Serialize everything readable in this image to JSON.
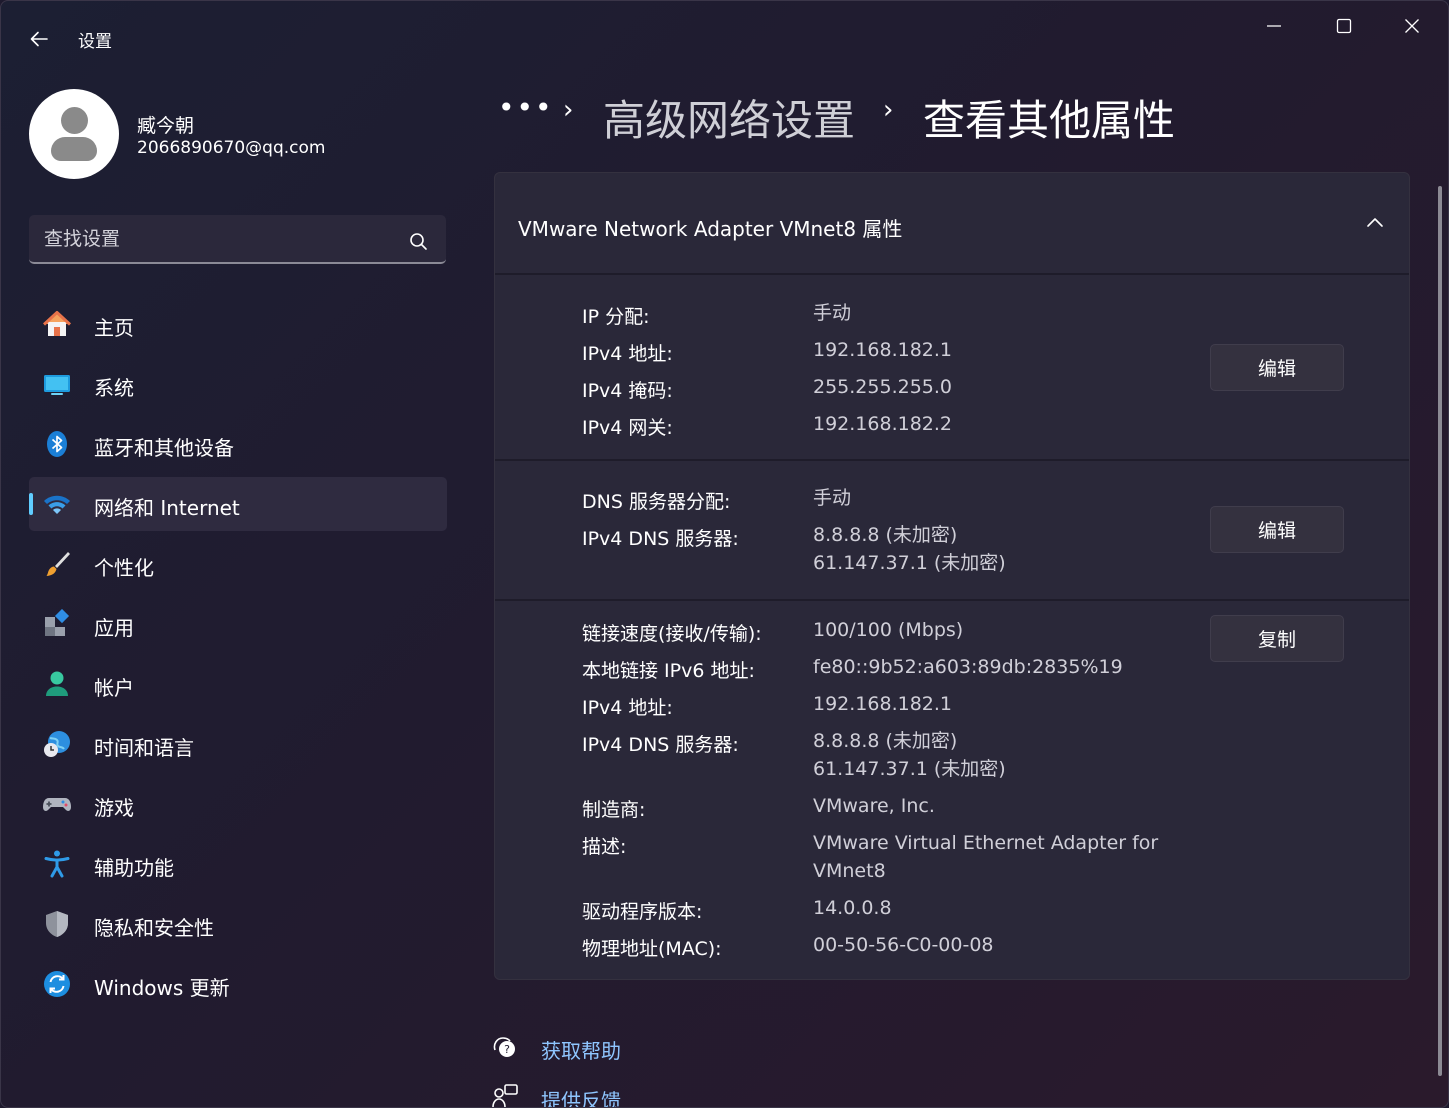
{
  "window": {
    "title": "设置"
  },
  "profile": {
    "name": "臧今朝",
    "email": "2066890670@qq.com"
  },
  "search": {
    "placeholder": "查找设置"
  },
  "nav": {
    "items": [
      {
        "label": "主页",
        "icon": "home-icon"
      },
      {
        "label": "系统",
        "icon": "system-icon"
      },
      {
        "label": "蓝牙和其他设备",
        "icon": "bluetooth-icon"
      },
      {
        "label": "网络和 Internet",
        "icon": "wifi-icon",
        "active": true
      },
      {
        "label": "个性化",
        "icon": "brush-icon"
      },
      {
        "label": "应用",
        "icon": "apps-icon"
      },
      {
        "label": "帐户",
        "icon": "account-icon"
      },
      {
        "label": "时间和语言",
        "icon": "globe-clock-icon"
      },
      {
        "label": "游戏",
        "icon": "gamepad-icon"
      },
      {
        "label": "辅助功能",
        "icon": "accessibility-icon"
      },
      {
        "label": "隐私和安全性",
        "icon": "shield-icon"
      },
      {
        "label": "Windows 更新",
        "icon": "update-icon"
      }
    ]
  },
  "breadcrumb": {
    "more": "•••",
    "separator": "›",
    "parent": "高级网络设置",
    "current": "查看其他属性"
  },
  "card": {
    "title": "VMware Network Adapter VMnet8 属性",
    "ip_section": {
      "rows": [
        {
          "label": "IP 分配:",
          "value": "手动"
        },
        {
          "label": "IPv4 地址:",
          "value": "192.168.182.1"
        },
        {
          "label": "IPv4 掩码:",
          "value": "255.255.255.0"
        },
        {
          "label": "IPv4 网关:",
          "value": "192.168.182.2"
        }
      ],
      "button": "编辑"
    },
    "dns_section": {
      "rows": [
        {
          "label": "DNS 服务器分配:",
          "value": "手动"
        },
        {
          "label": "IPv4 DNS 服务器:",
          "value": "8.8.8.8 (未加密)",
          "value2": "61.147.37.1 (未加密)"
        }
      ],
      "button": "编辑"
    },
    "info_section": {
      "rows": [
        {
          "label": "链接速度(接收/传输):",
          "value": "100/100 (Mbps)"
        },
        {
          "label": "本地链接 IPv6 地址:",
          "value": "fe80::9b52:a603:89db:2835%19"
        },
        {
          "label": "IPv4 地址:",
          "value": "192.168.182.1"
        },
        {
          "label": "IPv4 DNS 服务器:",
          "value": "8.8.8.8 (未加密)",
          "value2": "61.147.37.1 (未加密)"
        },
        {
          "label": "制造商:",
          "value": "VMware, Inc."
        },
        {
          "label": "描述:",
          "value": "VMware Virtual Ethernet Adapter for",
          "value2": "VMnet8"
        },
        {
          "label": "驱动程序版本:",
          "value": "14.0.0.8"
        },
        {
          "label": "物理地址(MAC):",
          "value": "00-50-56-C0-00-08"
        }
      ],
      "button": "复制"
    }
  },
  "links": {
    "help": "获取帮助",
    "feedback": "提供反馈"
  },
  "colors": {
    "accent": "#60cdff",
    "link": "#8fc6ff"
  }
}
